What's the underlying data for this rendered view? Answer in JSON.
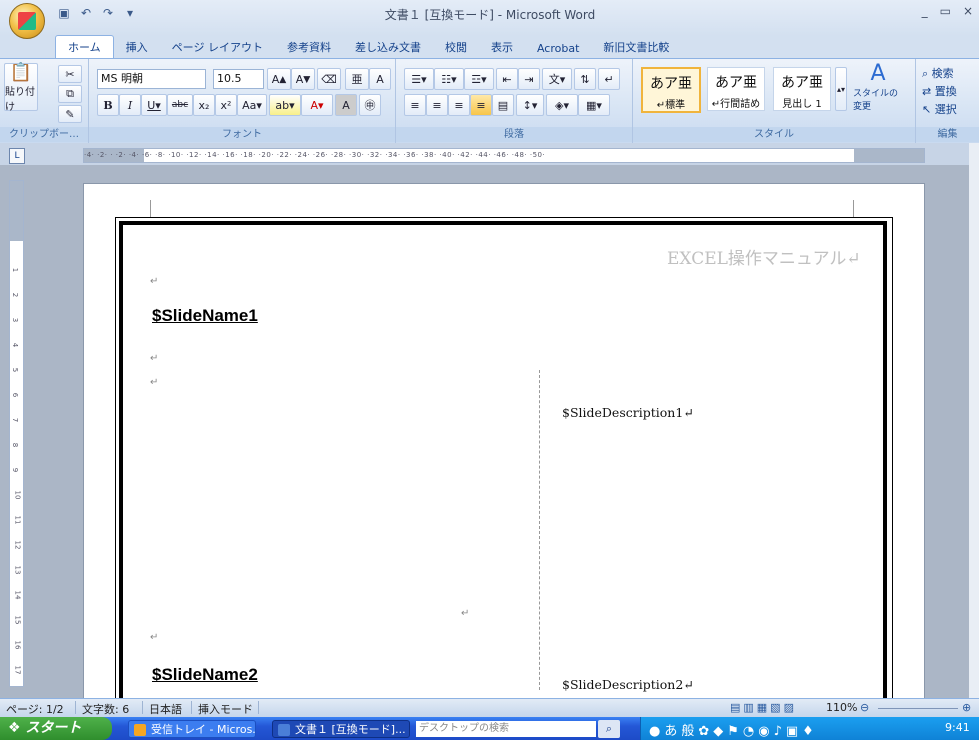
{
  "window": {
    "title": "文書１ [互換モード] - Microsoft Word",
    "controls": [
      "_",
      "▭",
      "×"
    ]
  },
  "tabs": [
    "ホーム",
    "挿入",
    "ページ レイアウト",
    "参考資料",
    "差し込み文書",
    "校閲",
    "表示",
    "Acrobat",
    "新旧文書比較"
  ],
  "active_tab": "ホーム",
  "ribbon": {
    "clipboard": {
      "paste": "貼り付け",
      "label": "クリップボー…"
    },
    "font": {
      "name": "MS 明朝",
      "size": "10.5",
      "label": "フォント"
    },
    "paragraph": {
      "label": "段落"
    },
    "styles": {
      "items": [
        {
          "sample": "あア亜",
          "name": "↵標準"
        },
        {
          "sample": "あア亜",
          "name": "↵行間詰め"
        },
        {
          "sample": "あア亜",
          "name": "見出し 1"
        }
      ],
      "change": "スタイルの変更",
      "label": "スタイル"
    },
    "editing": {
      "find": "検索",
      "replace": "置換",
      "select": "選択",
      "label": "編集"
    }
  },
  "document": {
    "header": "EXCEL操作マニュアル↵",
    "slide1_name": "$SlideName1",
    "slide1_desc": "$SlideDescription1↵",
    "slide2_name": "$SlideName2",
    "slide2_desc": "$SlideDescription2↵",
    "para_mark": "↵"
  },
  "ruler": {
    "h_ticks": "·4· ·2· · ·2· ·4· ·6· ·8· ·10· ·12· ·14· ·16· ·18· ·20· ·22· ·24· ·26· ·28· ·30· ·32· ·34· ·36· ·38· ·40· ·42· ·44· ·46· ·48· ·50·"
  },
  "status": {
    "page": "ページ: 1/2",
    "words": "文字数: 6",
    "lang": "日本語",
    "mode": "挿入モード",
    "zoom": "110%"
  },
  "taskbar": {
    "start": "スタート",
    "tasks": [
      "受信トレイ - Micros...",
      "文書１ [互換モード]..."
    ],
    "search_placeholder": "デスクトップの検索",
    "clock": "9:41"
  }
}
